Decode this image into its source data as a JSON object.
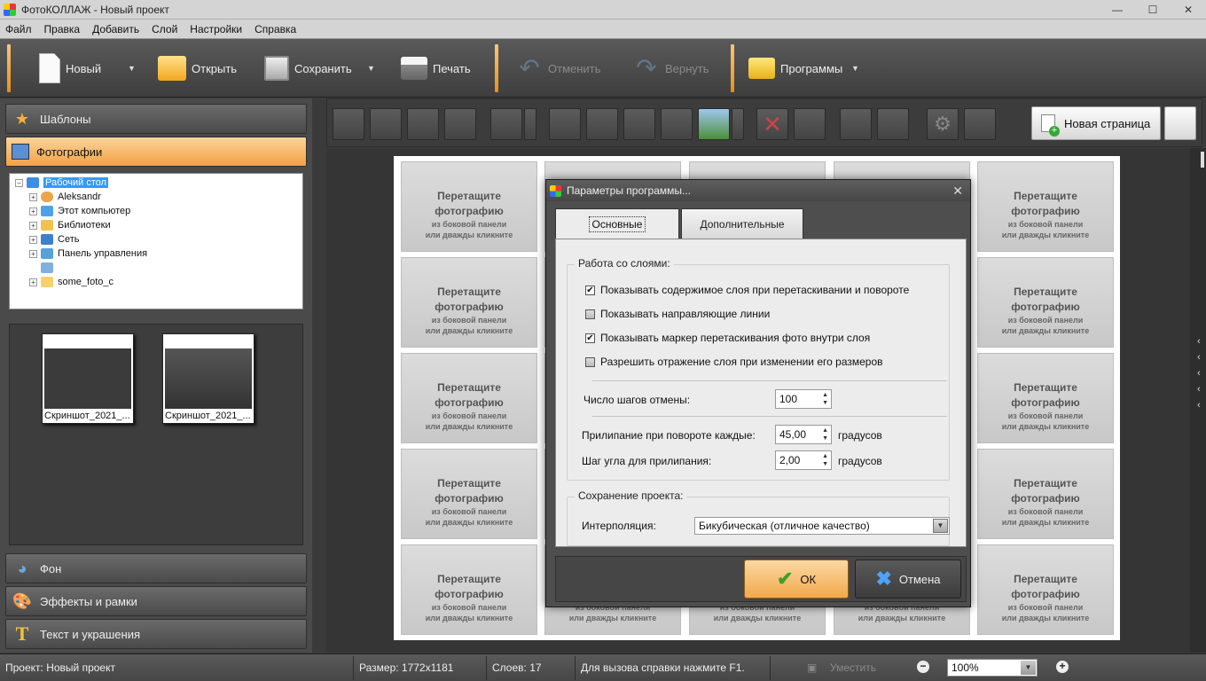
{
  "titlebar": {
    "title": "ФотоКОЛЛАЖ - Новый проект"
  },
  "menu": [
    "Файл",
    "Правка",
    "Добавить",
    "Слой",
    "Настройки",
    "Справка"
  ],
  "toolbar": {
    "new_label": "Новый",
    "open_label": "Открыть",
    "save_label": "Сохранить",
    "print_label": "Печать",
    "undo_label": "Отменить",
    "redo_label": "Вернуть",
    "programs_label": "Программы"
  },
  "left": {
    "templates_label": "Шаблоны",
    "photos_label": "Фотографии",
    "background_label": "Фон",
    "effects_label": "Эффекты и рамки",
    "text_label": "Текст и украшения",
    "tree": [
      "Рабочий стол",
      "Aleksandr",
      "Этот компьютер",
      "Библиотеки",
      "Сеть",
      "Панель управления",
      "some_foto_c"
    ],
    "thumbs": [
      "Скриншот_2021_...",
      "Скриншот_2021_..."
    ]
  },
  "workspace": {
    "new_page_label": "Новая страница",
    "placeholder_title_1": "Перетащите",
    "placeholder_title_2": "фотографию",
    "placeholder_sub_1": "из боковой панели",
    "placeholder_sub_2": "или дважды кликните",
    "partial_sub": "или дважды кликните"
  },
  "dialog": {
    "title": "Параметры программы...",
    "tab_main": "Основные",
    "tab_extra": "Дополнительные",
    "group_layers": "Работа со слоями:",
    "chk1": "Показывать содержимое слоя при перетаскивании и повороте",
    "chk2": "Показывать направляющие линии",
    "chk3": "Показывать маркер перетаскивания фото внутри слоя",
    "chk4": "Разрешить отражение слоя при изменении его размеров",
    "undo_steps_label": "Число шагов отмены:",
    "undo_steps_value": "100",
    "snap_label": "Прилипание при повороте каждые:",
    "snap_value": "45,00",
    "angle_label": "Шаг угла для прилипания:",
    "angle_value": "2,00",
    "degrees": "градусов",
    "group_save": "Сохранение проекта:",
    "interp_label": "Интерполяция:",
    "interp_value": "Бикубическая (отличное качество)",
    "ok_label": "ОК",
    "cancel_label": "Отмена",
    "checked": [
      true,
      false,
      true,
      false
    ]
  },
  "status": {
    "project": "Проект:  Новый проект",
    "size": "Размер:  1772x1181",
    "layers": "Слоев:  17",
    "help": "Для вызова справки нажмите F1.",
    "fit": "Уместить",
    "zoom": "100%"
  }
}
